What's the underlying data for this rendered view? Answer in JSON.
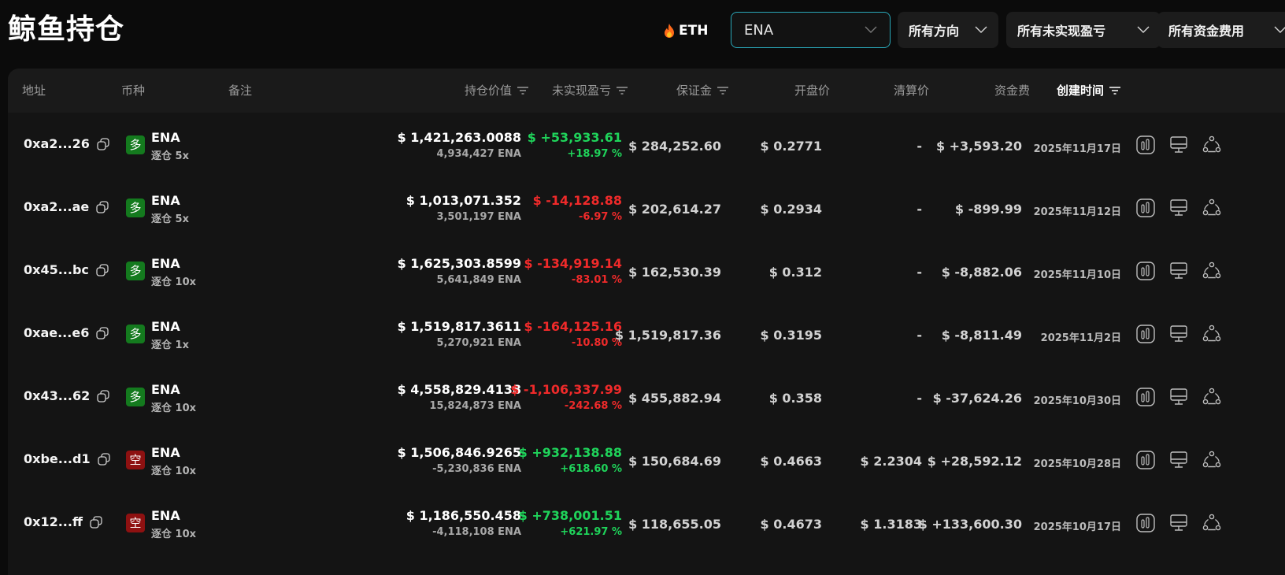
{
  "page_title": "鲸鱼持仓",
  "coin_tag": {
    "icon": "fire-icon",
    "label": "ETH"
  },
  "filters": {
    "coin_select": "ENA",
    "direction": "所有方向",
    "pnl": "所有未实现盈亏",
    "funding": "所有资金费用"
  },
  "columns": {
    "address": "地址",
    "coin": "币种",
    "note": "备注",
    "position_value": "持仓价值",
    "unrealized_pnl": "未实现盈亏",
    "margin": "保证金",
    "entry_price": "开盘价",
    "liquidation_price": "清算价",
    "funding": "资金费",
    "created_time": "创建时间"
  },
  "colors": {
    "positive": "#1fd35a",
    "negative": "#ef2a2a",
    "long_badge": "#147a1e",
    "short_badge": "#8e1111",
    "accent_border": "#2aa7b8"
  },
  "rows": [
    {
      "address": "0xa2...26",
      "side": "多",
      "side_type": "long",
      "coin": "ENA",
      "mode": "逐仓 5x",
      "value": "$ 1,421,263.0088",
      "amount": "4,934,427 ENA",
      "pnl": "$ +53,933.61",
      "pnl_pct": "+18.97 %",
      "pnl_sign": "pos",
      "margin": "$ 284,252.60",
      "entry": "$ 0.2771",
      "liq": "-",
      "funding": "$ +3,593.20",
      "funding_sign": "pos",
      "created": "2025年11月17日"
    },
    {
      "address": "0xa2...ae",
      "side": "多",
      "side_type": "long",
      "coin": "ENA",
      "mode": "逐仓 5x",
      "value": "$ 1,013,071.352",
      "amount": "3,501,197 ENA",
      "pnl": "$ -14,128.88",
      "pnl_pct": "-6.97 %",
      "pnl_sign": "neg",
      "margin": "$ 202,614.27",
      "entry": "$ 0.2934",
      "liq": "-",
      "funding": "$ -899.99",
      "funding_sign": "neg",
      "created": "2025年11月12日"
    },
    {
      "address": "0x45...bc",
      "side": "多",
      "side_type": "long",
      "coin": "ENA",
      "mode": "逐仓 10x",
      "value": "$ 1,625,303.8599",
      "amount": "5,641,849 ENA",
      "pnl": "$ -134,919.14",
      "pnl_pct": "-83.01 %",
      "pnl_sign": "neg",
      "margin": "$ 162,530.39",
      "entry": "$ 0.312",
      "liq": "-",
      "funding": "$ -8,882.06",
      "funding_sign": "neg",
      "created": "2025年11月10日"
    },
    {
      "address": "0xae...e6",
      "side": "多",
      "side_type": "long",
      "coin": "ENA",
      "mode": "逐仓 1x",
      "value": "$ 1,519,817.3611",
      "amount": "5,270,921 ENA",
      "pnl": "$ -164,125.16",
      "pnl_pct": "-10.80 %",
      "pnl_sign": "neg",
      "margin": "$ 1,519,817.36",
      "entry": "$ 0.3195",
      "liq": "-",
      "funding": "$ -8,811.49",
      "funding_sign": "neg",
      "created": "2025年11月2日"
    },
    {
      "address": "0x43...62",
      "side": "多",
      "side_type": "long",
      "coin": "ENA",
      "mode": "逐仓 10x",
      "value": "$ 4,558,829.4138",
      "amount": "15,824,873 ENA",
      "pnl": "$ -1,106,337.99",
      "pnl_pct": "-242.68 %",
      "pnl_sign": "neg",
      "margin": "$ 455,882.94",
      "entry": "$ 0.358",
      "liq": "-",
      "funding": "$ -37,624.26",
      "funding_sign": "neg",
      "created": "2025年10月30日"
    },
    {
      "address": "0xbe...d1",
      "side": "空",
      "side_type": "short",
      "coin": "ENA",
      "mode": "逐仓 10x",
      "value": "$ 1,506,846.9265",
      "amount": "-5,230,836 ENA",
      "pnl": "$ +932,138.88",
      "pnl_pct": "+618.60 %",
      "pnl_sign": "pos",
      "margin": "$ 150,684.69",
      "entry": "$ 0.4663",
      "liq": "$ 2.2304",
      "funding": "$ +28,592.12",
      "funding_sign": "pos",
      "created": "2025年10月28日"
    },
    {
      "address": "0x12...ff",
      "side": "空",
      "side_type": "short",
      "coin": "ENA",
      "mode": "逐仓 10x",
      "value": "$ 1,186,550.458",
      "amount": "-4,118,108 ENA",
      "pnl": "$ +738,001.51",
      "pnl_pct": "+621.97 %",
      "pnl_sign": "pos",
      "margin": "$ 118,655.05",
      "entry": "$ 0.4673",
      "liq": "$ 1.3183",
      "funding": "$ +133,600.30",
      "funding_sign": "pos",
      "created": "2025年10月17日"
    }
  ],
  "row_actions": [
    "chart-icon",
    "monitor-icon",
    "share-icon"
  ]
}
